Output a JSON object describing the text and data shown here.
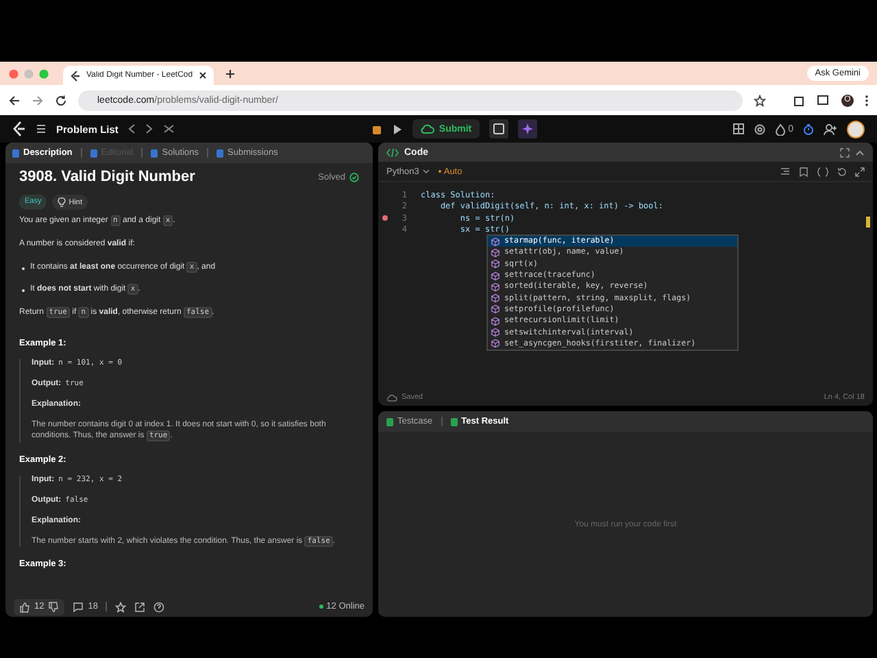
{
  "browser": {
    "tab_title": "Valid Digit Number - LeetCod",
    "ask_button": "Ask Gemini",
    "url_host": "leetcode.com",
    "url_path": "/problems/valid-digit-number/",
    "profile": "O"
  },
  "app_bar": {
    "problem_list": "Problem List",
    "submit": "Submit",
    "streak": "0"
  },
  "description_panel": {
    "tabs": [
      {
        "label": "Description",
        "selected": true,
        "disabled": false
      },
      {
        "label": "Editorial",
        "selected": false,
        "disabled": true
      },
      {
        "label": "Solutions",
        "selected": false,
        "disabled": false
      },
      {
        "label": "Submissions",
        "selected": false,
        "disabled": false
      }
    ],
    "title": "3908. Valid Digit Number",
    "status": "Solved",
    "difficulty": "Easy",
    "hint": "Hint",
    "paragraphs": [
      {
        "kind": "para",
        "parts": [
          {
            "kind": "text",
            "text": "You are given an integer "
          },
          {
            "kind": "code",
            "text": "n"
          },
          {
            "kind": "text",
            "text": " and a digit "
          },
          {
            "kind": "code",
            "text": "x"
          },
          {
            "kind": "text",
            "text": "."
          }
        ]
      },
      {
        "kind": "para",
        "parts": [
          {
            "kind": "text",
            "text": "A number is considered **valid** if:"
          }
        ]
      },
      {
        "kind": "bullet",
        "parts": [
          {
            "kind": "text",
            "text": "It contains **at least one** occurrence of digit "
          },
          {
            "kind": "code",
            "text": "x"
          },
          {
            "kind": "text",
            "text": ", and"
          }
        ]
      },
      {
        "kind": "bullet",
        "parts": [
          {
            "kind": "text",
            "text": "It **does not start** with digit "
          },
          {
            "kind": "code",
            "text": "x"
          },
          {
            "kind": "text",
            "text": "."
          }
        ]
      },
      {
        "kind": "para",
        "parts": [
          {
            "kind": "text",
            "text": "Return "
          },
          {
            "kind": "code",
            "text": "true"
          },
          {
            "kind": "text",
            "text": " if "
          },
          {
            "kind": "code",
            "text": "n"
          },
          {
            "kind": "text",
            "text": " is **valid**, otherwise return "
          },
          {
            "kind": "code",
            "text": "false"
          },
          {
            "kind": "text",
            "text": "."
          }
        ]
      }
    ],
    "examples": [
      {
        "title": "Example 1:",
        "input_label": "Input:",
        "input": "n = 101, x = 0",
        "output_label": "Output:",
        "output": "true",
        "explanation_label": "Explanation:",
        "explanation": [
          {
            "kind": "text",
            "text": "The number contains digit 0 at index 1. It does not start with 0, so it satisfies both conditions. Thus, the answer is "
          },
          {
            "kind": "code",
            "text": "true"
          },
          {
            "kind": "text",
            "text": "."
          }
        ]
      },
      {
        "title": "Example 2:",
        "input_label": "Input:",
        "input": "n = 232, x = 2",
        "output_label": "Output:",
        "output": "false",
        "explanation_label": "Explanation:",
        "explanation": [
          {
            "kind": "text",
            "text": "The number starts with 2, which violates the condition. Thus, the answer is "
          },
          {
            "kind": "code",
            "text": "false"
          },
          {
            "kind": "text",
            "text": "."
          }
        ]
      },
      {
        "title": "Example 3:"
      }
    ],
    "footer": {
      "likes": "12",
      "comments": "18",
      "online": "12 Online"
    }
  },
  "code_panel": {
    "title": "Code",
    "language": "Python3",
    "mode": "Auto",
    "lines": [
      {
        "number": "1",
        "text": "class Solution:",
        "breakpoint": false
      },
      {
        "number": "2",
        "text": "    def validDigit(self, n: int, x: int) -> bool:",
        "breakpoint": false
      },
      {
        "number": "3",
        "text": "        ns = str(n)",
        "breakpoint": true
      },
      {
        "number": "4",
        "text": "        sx = str()",
        "breakpoint": false
      }
    ],
    "suggestions": [
      {
        "text": "starmap(func, iterable)",
        "selected": true
      },
      {
        "text": "setattr(obj, name, value)",
        "selected": false
      },
      {
        "text": "sqrt(x)",
        "selected": false
      },
      {
        "text": "settrace(tracefunc)",
        "selected": false
      },
      {
        "text": "sorted(iterable, key, reverse)",
        "selected": false
      },
      {
        "text": "split(pattern, string, maxsplit, flags)",
        "selected": false
      },
      {
        "text": "setprofile(profilefunc)",
        "selected": false
      },
      {
        "text": "setrecursionlimit(limit)",
        "selected": false
      },
      {
        "text": "setswitchinterval(interval)",
        "selected": false
      },
      {
        "text": "set_asyncgen_hooks(firstiter, finalizer)",
        "selected": false
      }
    ],
    "saved": "Saved",
    "cursor": "Ln 4, Col 18"
  },
  "test_panel": {
    "tabs": [
      {
        "label": "Testcase",
        "selected": false
      },
      {
        "label": "Test Result",
        "selected": true
      }
    ],
    "message": "You must run your code first"
  }
}
